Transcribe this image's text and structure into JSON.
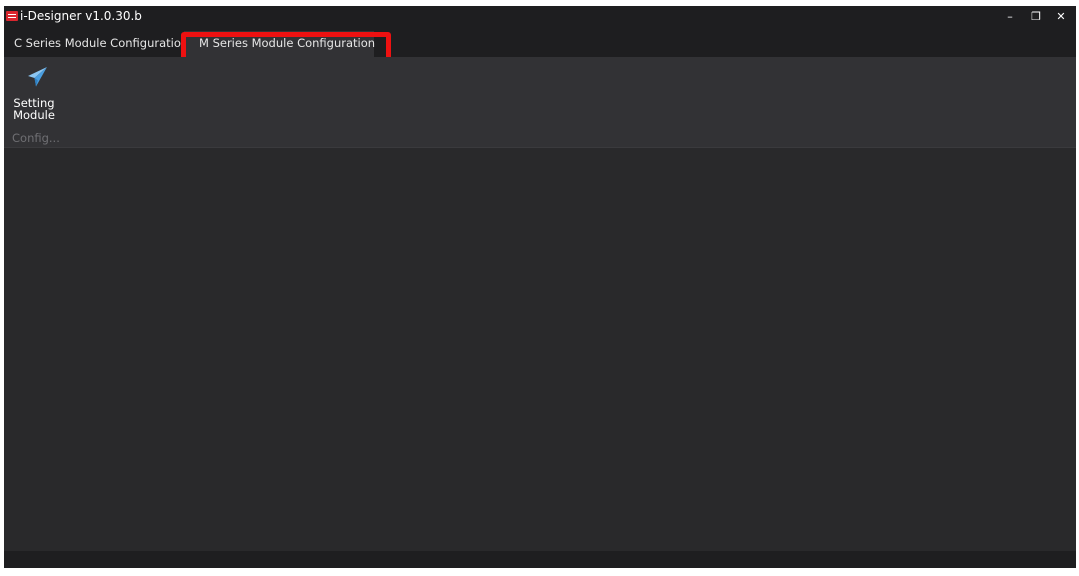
{
  "window": {
    "title": "i-Designer v1.0.30.b",
    "controls": {
      "minimize": "–",
      "restore": "❐",
      "close": "✕"
    }
  },
  "tabs": [
    {
      "label": "C Series Module Configuration",
      "active": false
    },
    {
      "label": "M Series Module Configuration",
      "active": true
    }
  ],
  "ribbon": {
    "buttons": [
      {
        "label": "Setting\nModule",
        "icon": "paper-plane-icon"
      }
    ],
    "group_label": "Config..."
  },
  "colors": {
    "accent": "#5aa8e6",
    "highlight": "#ee1111",
    "logo": "#d9262e"
  }
}
